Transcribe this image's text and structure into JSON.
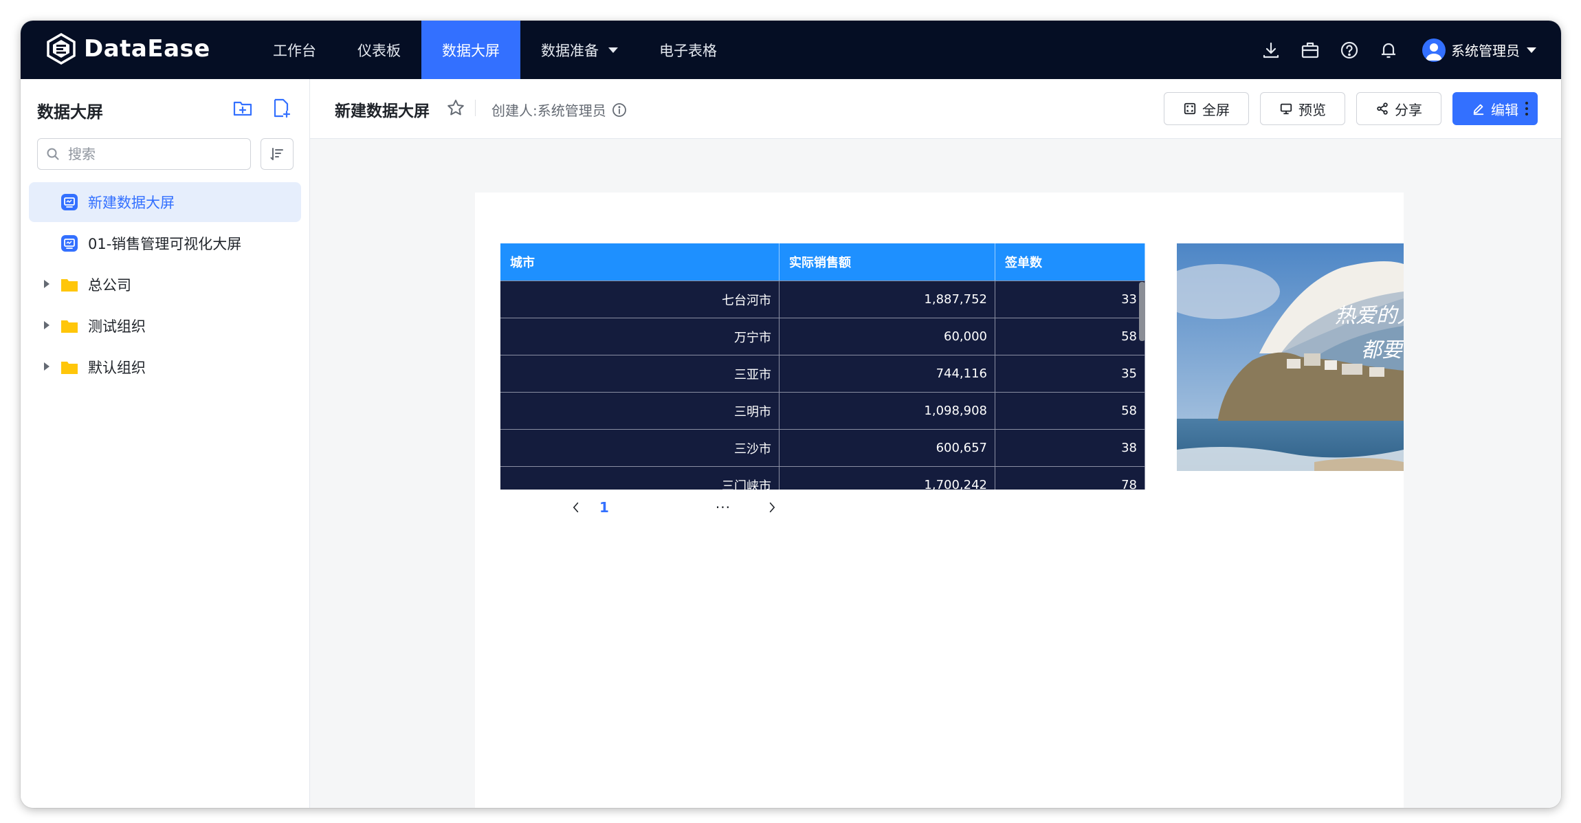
{
  "app": {
    "brand": "DataEase",
    "nav": [
      {
        "label": "工作台",
        "active": false
      },
      {
        "label": "仪表板",
        "active": false
      },
      {
        "label": "数据大屏",
        "active": true
      },
      {
        "label": "数据准备",
        "active": false,
        "has_dropdown": true
      },
      {
        "label": "电子表格",
        "active": false
      }
    ],
    "top_icons": [
      "download-icon",
      "toolbox-icon",
      "help-icon",
      "bell-icon"
    ],
    "user": {
      "name": "系统管理员"
    }
  },
  "sidebar": {
    "title": "数据大屏",
    "search_placeholder": "搜索",
    "items": [
      {
        "label": "新建数据大屏",
        "type": "screen",
        "selected": true
      },
      {
        "label": "01-销售管理可视化大屏",
        "type": "screen",
        "selected": false
      },
      {
        "label": "总公司",
        "type": "folder",
        "selected": false
      },
      {
        "label": "测试组织",
        "type": "folder",
        "selected": false
      },
      {
        "label": "默认组织",
        "type": "folder",
        "selected": false
      }
    ]
  },
  "main": {
    "title": "新建数据大屏",
    "creator": "创建人:系统管理员",
    "buttons": {
      "fullscreen": "全屏",
      "preview": "预览",
      "share": "分享",
      "edit": "编辑"
    },
    "table": {
      "columns": [
        "城市",
        "实际销售额",
        "签单数"
      ],
      "rows": [
        [
          "七台河市",
          "1,887,752",
          "33"
        ],
        [
          "万宁市",
          "60,000",
          "58"
        ],
        [
          "三亚市",
          "744,116",
          "35"
        ],
        [
          "三明市",
          "1,098,908",
          "58"
        ],
        [
          "三沙市",
          "600,657",
          "38"
        ],
        [
          "三门峡市",
          "1,700,242",
          "78"
        ]
      ]
    },
    "pager": {
      "current": "1",
      "ellipsis": "···"
    },
    "image": {
      "overlay_text_1": "热爱的人",
      "overlay_text_2": "都要"
    }
  },
  "colors": {
    "topbar": "#050e24",
    "accent": "#3370ff",
    "table_header": "#1e90ff",
    "table_body": "#141c3d",
    "folder": "#ffc60a"
  }
}
